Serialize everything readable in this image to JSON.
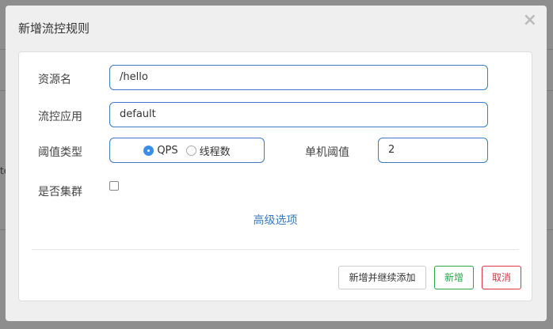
{
  "background": {
    "fragment": "te"
  },
  "dialog": {
    "title": "新增流控规则",
    "close_icon": "×",
    "fields": {
      "resource": {
        "label": "资源名",
        "value": "/hello"
      },
      "app": {
        "label": "流控应用",
        "value": "default"
      },
      "threshold_type": {
        "label": "阈值类型",
        "options": [
          "QPS",
          "线程数"
        ],
        "selected": "QPS"
      },
      "single_threshold": {
        "label": "单机阈值",
        "value": "2"
      },
      "cluster": {
        "label": "是否集群",
        "checked": false
      }
    },
    "advanced_link": "高级选项",
    "buttons": {
      "add_continue": "新增并继续添加",
      "add": "新增",
      "cancel": "取消"
    },
    "colors": {
      "primary": "#3b7bbf",
      "success": "#28a745",
      "danger": "#dc3545"
    }
  }
}
